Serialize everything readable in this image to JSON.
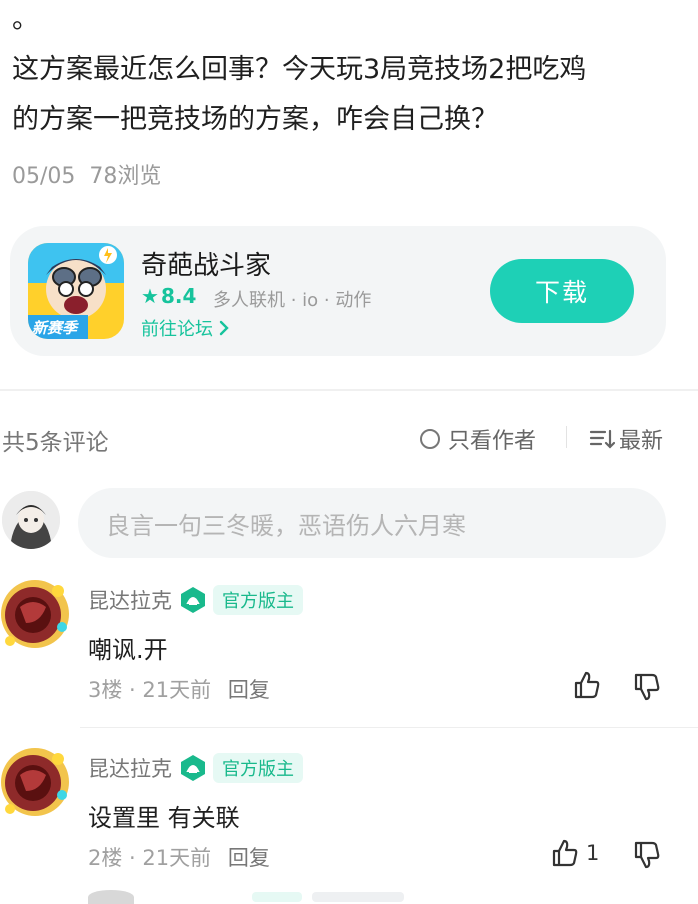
{
  "post": {
    "lines": [
      "。",
      "这方案最近怎么回事？今天玩3局竞技场2把吃鸡",
      "的方案一把竞技场的方案，咋会自己换？"
    ],
    "date": "05/05",
    "views": "78浏览"
  },
  "app_card": {
    "name": "奇葩战斗家",
    "rating": "8.4",
    "tags": "多人联机 · io · 动作",
    "forum_link": "前往论坛",
    "download": "下载",
    "icon_badge": "新赛季",
    "colors": {
      "accent": "#1ed0b6",
      "rating": "#16c39c"
    }
  },
  "comments_header": {
    "count": "共5条评论",
    "author_only": "只看作者",
    "sort": "最新"
  },
  "reply_box": {
    "placeholder": "良言一句三冬暖，恶语伤人六月寒"
  },
  "comments": [
    {
      "author": "昆达拉克",
      "badge": "官方版主",
      "text": "嘲讽.开",
      "floor": "3楼",
      "time": "21天前",
      "reply": "回复",
      "likes": ""
    },
    {
      "author": "昆达拉克",
      "badge": "官方版主",
      "text": "设置里 有关联",
      "floor": "2楼",
      "time": "21天前",
      "reply": "回复",
      "likes": "1"
    }
  ]
}
